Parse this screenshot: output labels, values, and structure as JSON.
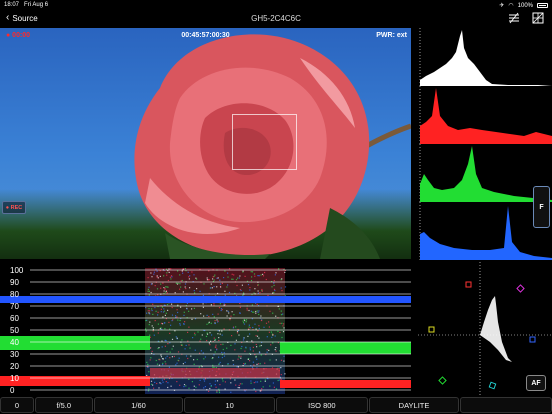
{
  "status": {
    "time": "18:07",
    "date": "Fri Aug 6",
    "battery": "100%"
  },
  "nav": {
    "back_label": "Source",
    "title": "GH5-2C4C6C"
  },
  "monitor": {
    "rec_time": "● 00:00",
    "timecode": "00:45:57:00:30",
    "power": "PWR: ext",
    "rec_button": "● REC"
  },
  "scopes": {
    "focus_tab": "F",
    "af_button": "AF",
    "waveform_ticks": [
      "100",
      "90",
      "80",
      "70",
      "60",
      "50",
      "40",
      "30",
      "20",
      "10",
      "0"
    ],
    "colors": {
      "luma": "#ffffff",
      "red": "#ff2222",
      "green": "#22dd33",
      "blue": "#2266ff"
    }
  },
  "camera": {
    "aperture": "f/5.0",
    "shutter": "1/60",
    "gain": "10",
    "iso": "ISO 800",
    "white_balance": "DAYLITE"
  }
}
